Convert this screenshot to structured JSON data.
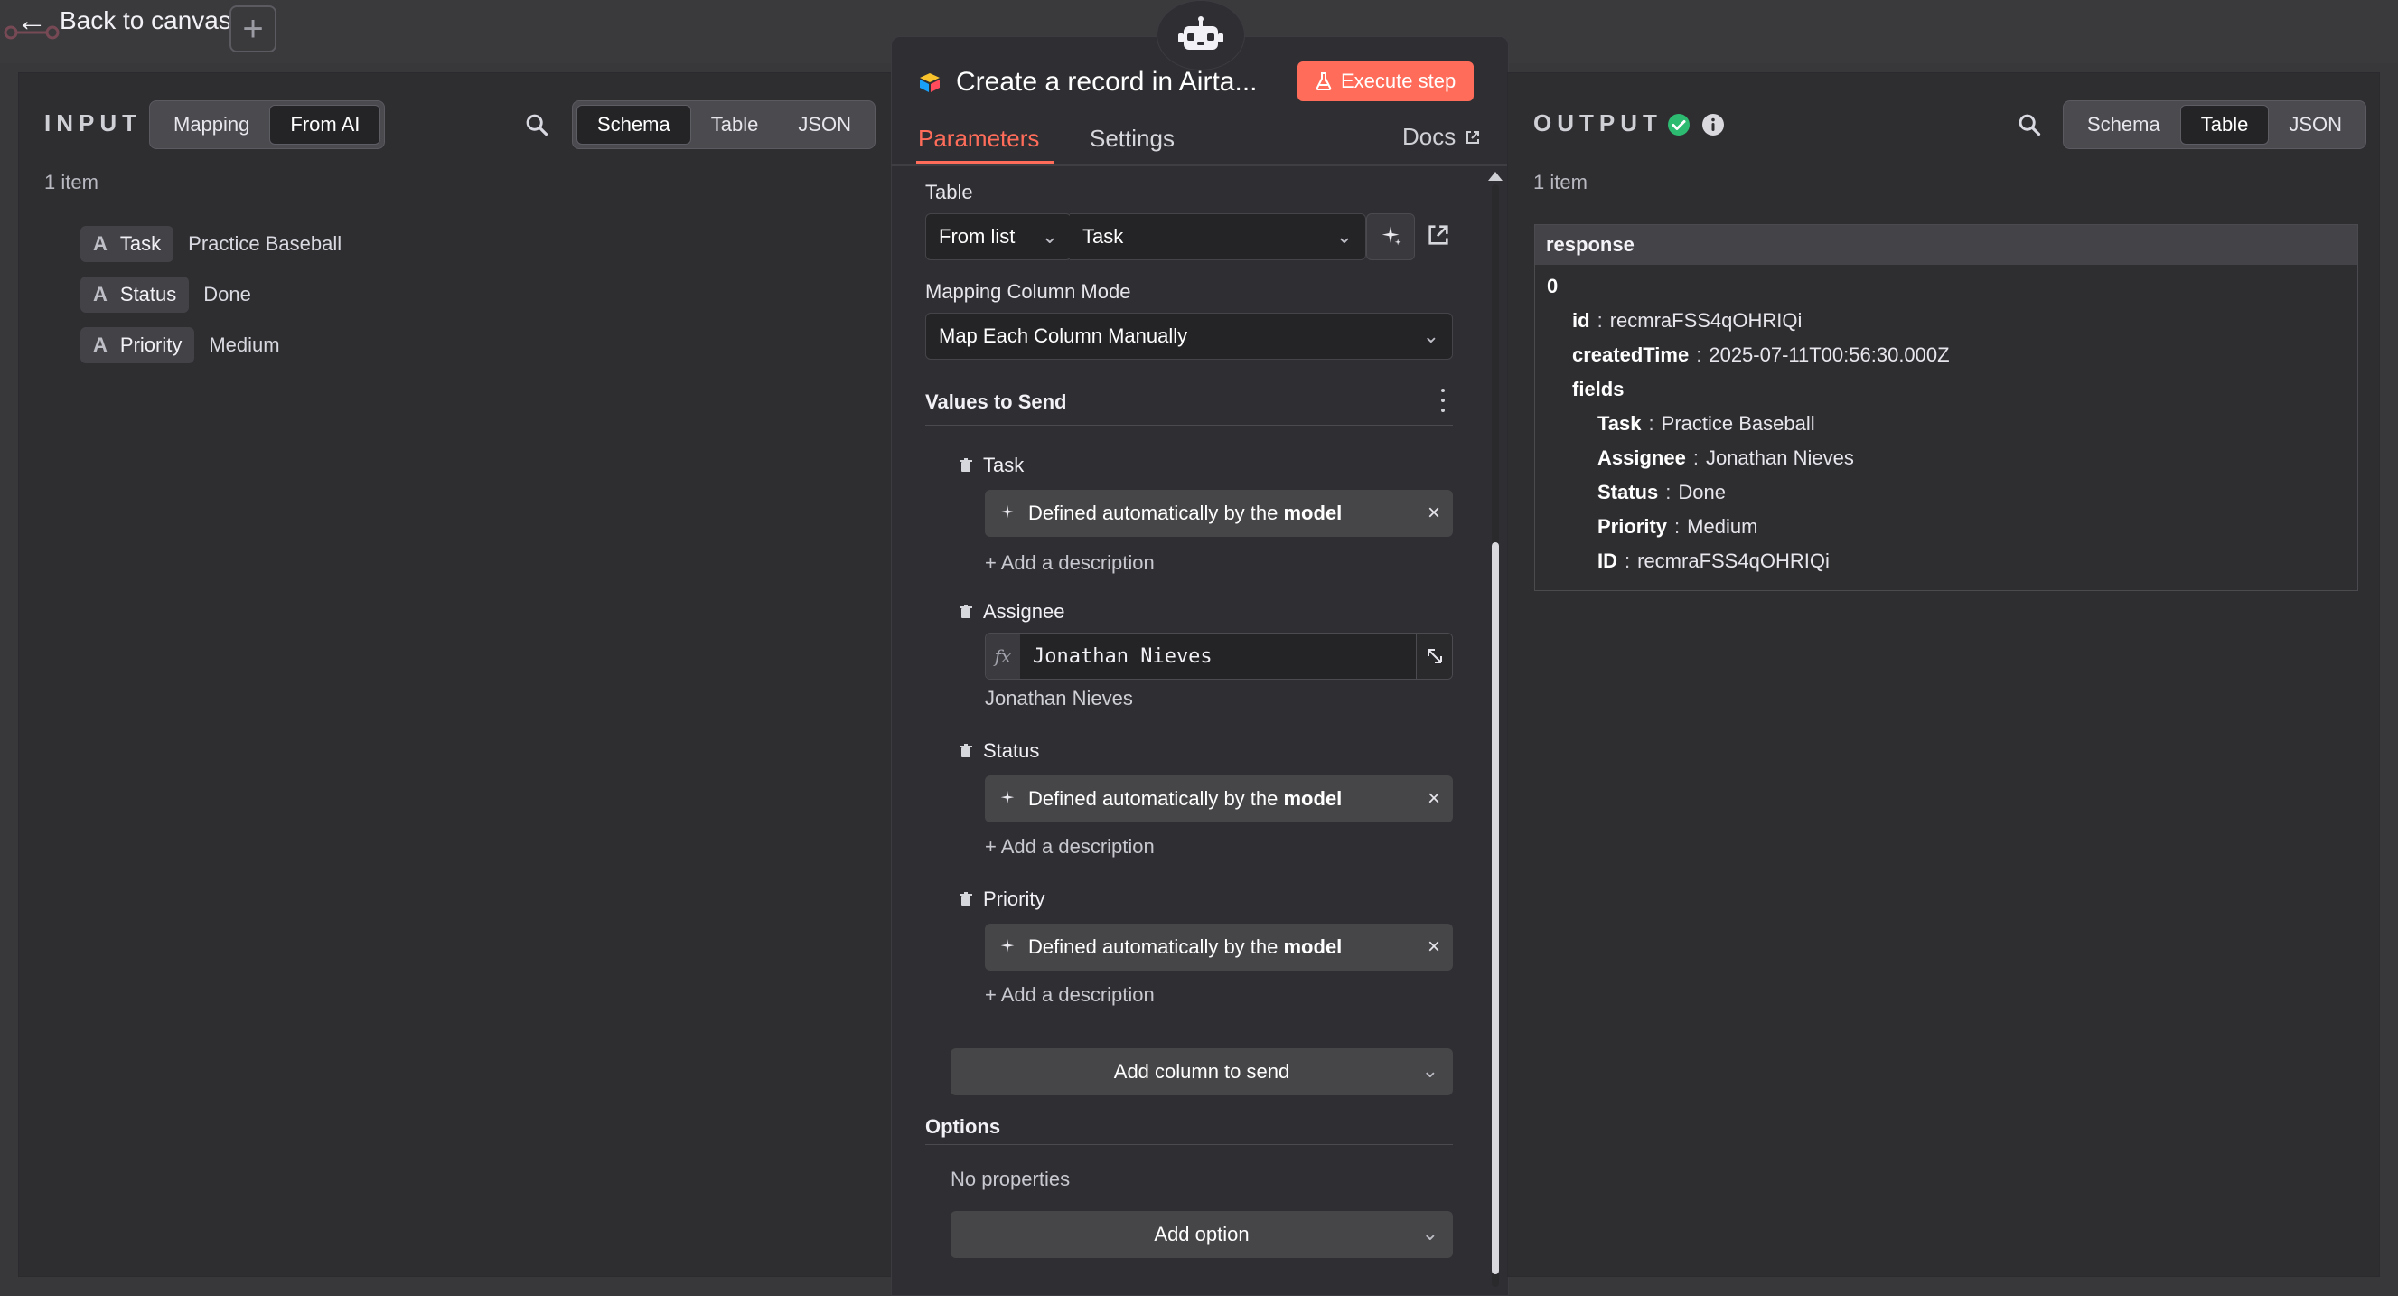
{
  "top": {
    "back_label": "Back to canvas"
  },
  "input": {
    "title": "INPUT",
    "mode_tabs": [
      "Mapping",
      "From AI"
    ],
    "active_mode": "From AI",
    "view_tabs": [
      "Schema",
      "Table",
      "JSON"
    ],
    "active_view": "Schema",
    "count": "1 item",
    "fields": [
      {
        "type": "A",
        "name": "Task",
        "value": "Practice Baseball"
      },
      {
        "type": "A",
        "name": "Status",
        "value": "Done"
      },
      {
        "type": "A",
        "name": "Priority",
        "value": "Medium"
      }
    ]
  },
  "center": {
    "title": "Create a record in Airta...",
    "execute_label": "Execute step",
    "tabs": [
      "Parameters",
      "Settings"
    ],
    "active_tab": "Parameters",
    "docs_label": "Docs",
    "table_label": "Table",
    "table_from": "From list",
    "table_value": "Task",
    "mapping_mode_label": "Mapping Column Mode",
    "mapping_mode_value": "Map Each Column Manually",
    "values_to_send_label": "Values to Send",
    "ai_defined_prefix": "Defined automatically by the",
    "ai_defined_bold": "model",
    "add_description_label": "+ Add a description",
    "fields": [
      {
        "name": "Task",
        "kind": "ai"
      },
      {
        "name": "Assignee",
        "kind": "expr",
        "expr_value": "Jonathan Nieves",
        "preview": "Jonathan Nieves"
      },
      {
        "name": "Status",
        "kind": "ai"
      },
      {
        "name": "Priority",
        "kind": "ai"
      }
    ],
    "add_column_label": "Add column to send",
    "options_label": "Options",
    "no_properties_label": "No properties",
    "add_option_label": "Add option"
  },
  "output": {
    "title": "OUTPUT",
    "view_tabs": [
      "Schema",
      "Table",
      "JSON"
    ],
    "active_view": "Table",
    "count": "1 item",
    "response_header": "response",
    "index": "0",
    "fields": {
      "id_key": "id",
      "id_value": "recmraFSS4qOHRIQi",
      "createdTime_key": "createdTime",
      "createdTime_value": "2025-07-11T00:56:30.000Z",
      "fields_key": "fields",
      "task_key": "Task",
      "task_value": "Practice Baseball",
      "assignee_key": "Assignee",
      "assignee_value": "Jonathan Nieves",
      "status_key": "Status",
      "status_value": "Done",
      "priority_key": "Priority",
      "priority_value": "Medium",
      "ID_key": "ID",
      "ID_value": "recmraFSS4qOHRIQi"
    }
  },
  "colors": {
    "accent": "#ff6d5a",
    "success": "#2dbb72"
  }
}
